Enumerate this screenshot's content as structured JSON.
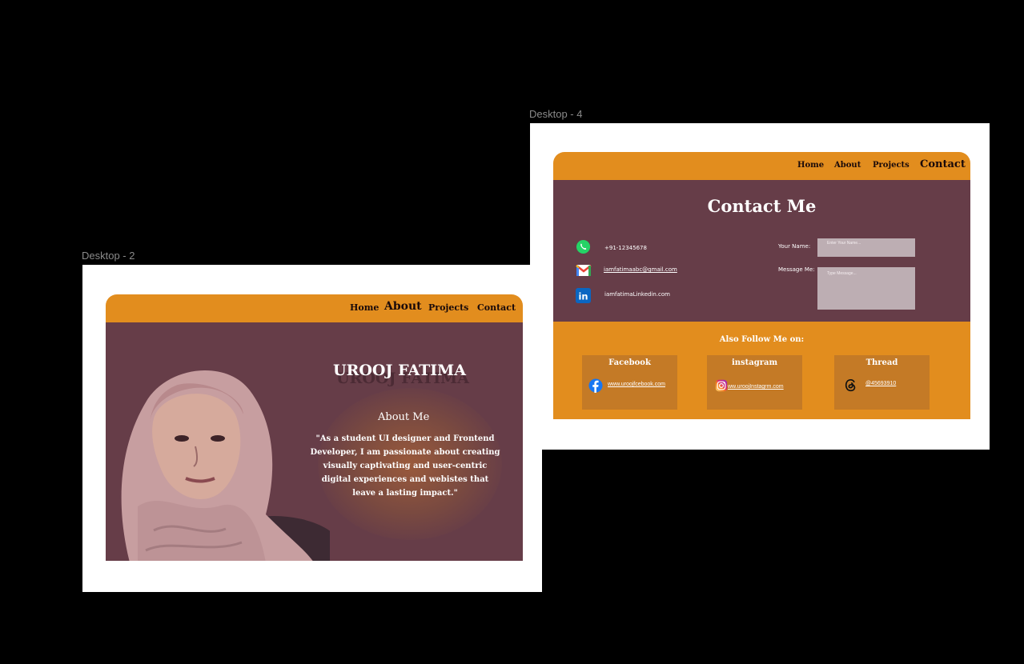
{
  "frames": {
    "about_label": "Desktop - 2",
    "contact_label": "Desktop - 4"
  },
  "about_page": {
    "nav": [
      "Home",
      "About",
      "Projects",
      "Contact"
    ],
    "name": "UROOJ FATIMA",
    "heading": "About Me",
    "bio_lines": [
      "\"As a student UI designer and Frontend",
      "Developer, I am passionate about creating",
      "visually captivating and user-centric",
      "digital experiences  and webistes that",
      "leave a lasting impact.\""
    ]
  },
  "contact_page": {
    "nav": [
      "Home",
      "About",
      "Projects",
      "Contact"
    ],
    "heading": "Contact Me",
    "phone": "+91-12345678",
    "email": "iamfatimaabc@gmail.com",
    "linkedin": "iamfatimaLinkedin.com",
    "form": {
      "name_label": "Your Name:",
      "name_placeholder": "Enter Your Name...",
      "message_label": "Message Me:",
      "message_placeholder": "Type Message..."
    },
    "follow_title": "Also Follow Me on:",
    "cards": [
      {
        "title": "Facebook",
        "link": "www.uroojfcebook.com",
        "icon": "facebook-icon"
      },
      {
        "title": "instagram",
        "link": "ww.uroojInstagrm.com",
        "icon": "instagram-icon"
      },
      {
        "title": "Thread",
        "link": "@45693910",
        "icon": "threads-icon"
      }
    ]
  },
  "colors": {
    "accent": "#e28d1e",
    "maroon": "#663d48",
    "card": "#c47a26"
  }
}
